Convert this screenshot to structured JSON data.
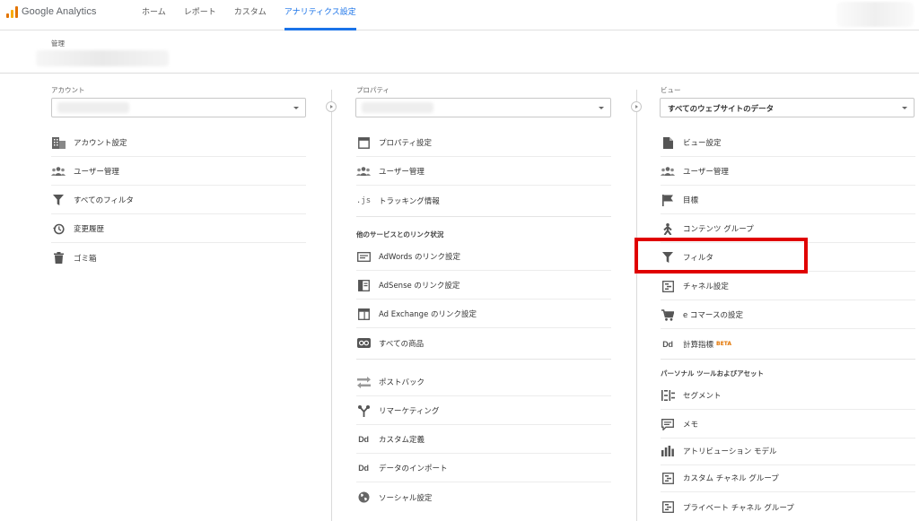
{
  "app": {
    "name": "Google Analytics"
  },
  "nav": {
    "items": [
      {
        "label": "ホーム",
        "active": false
      },
      {
        "label": "レポート",
        "active": false
      },
      {
        "label": "カスタム",
        "active": false
      },
      {
        "label": "アナリティクス設定",
        "active": true
      }
    ]
  },
  "admin": {
    "label": "管理"
  },
  "account": {
    "label": "アカウント",
    "items": [
      {
        "label": "アカウント設定",
        "icon": "building-icon"
      },
      {
        "label": "ユーザー管理",
        "icon": "users-icon"
      },
      {
        "label": "すべてのフィルタ",
        "icon": "filter-icon"
      },
      {
        "label": "変更履歴",
        "icon": "history-icon"
      },
      {
        "label": "ゴミ箱",
        "icon": "trash-icon"
      }
    ]
  },
  "property": {
    "label": "プロパティ",
    "items": [
      {
        "label": "プロパティ設定",
        "icon": "window-icon"
      },
      {
        "label": "ユーザー管理",
        "icon": "users-icon"
      },
      {
        "label": "トラッキング情報",
        "icon": "js-icon"
      }
    ],
    "linking_header": "他のサービスとのリンク状況",
    "linking_items": [
      {
        "label": "AdWords のリンク設定",
        "icon": "adwords-icon"
      },
      {
        "label": "AdSense のリンク設定",
        "icon": "adsense-icon"
      },
      {
        "label": "Ad Exchange のリンク設定",
        "icon": "adexchange-icon"
      },
      {
        "label": "すべての商品",
        "icon": "link-all-icon"
      }
    ],
    "other_items": [
      {
        "label": "ポストバック",
        "icon": "postback-icon"
      },
      {
        "label": "リマーケティング",
        "icon": "remarketing-icon"
      },
      {
        "label": "カスタム定義",
        "icon": "dd-icon"
      },
      {
        "label": "データのインポート",
        "icon": "dd-icon"
      },
      {
        "label": "ソーシャル設定",
        "icon": "globe-icon"
      }
    ],
    "dd_glyph": "Dd",
    "js_glyph": ".js"
  },
  "view": {
    "label": "ビュー",
    "selected": "すべてのウェブサイトのデータ",
    "items": [
      {
        "label": "ビュー設定",
        "icon": "document-icon"
      },
      {
        "label": "ユーザー管理",
        "icon": "users-icon"
      },
      {
        "label": "目標",
        "icon": "flag-icon"
      },
      {
        "label": "コンテンツ グループ",
        "icon": "person-walk-icon"
      },
      {
        "label": "フィルタ",
        "icon": "filter-icon",
        "highlighted": true
      },
      {
        "label": "チャネル設定",
        "icon": "channel-icon"
      },
      {
        "label": "e コマースの設定",
        "icon": "cart-icon"
      },
      {
        "label": "計算指標",
        "icon": "dd-icon",
        "badge": "BETA"
      }
    ],
    "personal_header": "パーソナル ツールおよびアセット",
    "personal_items": [
      {
        "label": "セグメント",
        "icon": "segment-icon"
      },
      {
        "label": "メモ",
        "icon": "note-icon"
      },
      {
        "label": "アトリビューション モデル",
        "icon": "bar-chart-icon"
      },
      {
        "label": "カスタム チャネル グループ",
        "icon": "channel-icon"
      },
      {
        "label": "プライベート チャネル グループ",
        "icon": "channel-icon"
      }
    ]
  },
  "colors": {
    "accent": "#1a73e8",
    "highlight": "#e00000",
    "icon": "#5f6368"
  }
}
